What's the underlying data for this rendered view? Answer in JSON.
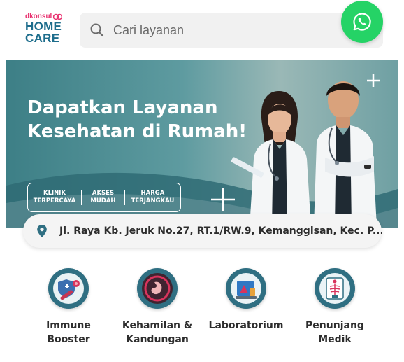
{
  "header": {
    "logo_brand": "dkonsul",
    "logo_line1": "HOME",
    "logo_line2": "CARE",
    "search_placeholder": "Cari layanan",
    "whatsapp_icon": "whatsapp-icon"
  },
  "banner": {
    "title_line1": "Dapatkan Layanan",
    "title_line2": "Kesehatan di Rumah!",
    "badges": [
      "KLINIK\nTERPERCAYA",
      "AKSES\nMUDAH",
      "HARGA\nTERJANGKAU"
    ]
  },
  "address": {
    "text": "Jl. Raya Kb. Jeruk No.27, RT.1/RW.9, Kemanggisan, Kec. P...",
    "icon": "location-pin-icon"
  },
  "categories": [
    {
      "label": "Immune\nBooster",
      "icon": "immune-booster-icon"
    },
    {
      "label": "Kehamilan &\nKandungan",
      "icon": "pregnancy-icon"
    },
    {
      "label": "Laboratorium",
      "icon": "laboratory-icon"
    },
    {
      "label": "Penunjang\nMedik",
      "icon": "xray-icon"
    }
  ],
  "colors": {
    "brand_pink": "#e8316f",
    "brand_teal": "#1d6d8c",
    "whatsapp_green": "#25d366",
    "banner_teal": "#3d7f86"
  }
}
